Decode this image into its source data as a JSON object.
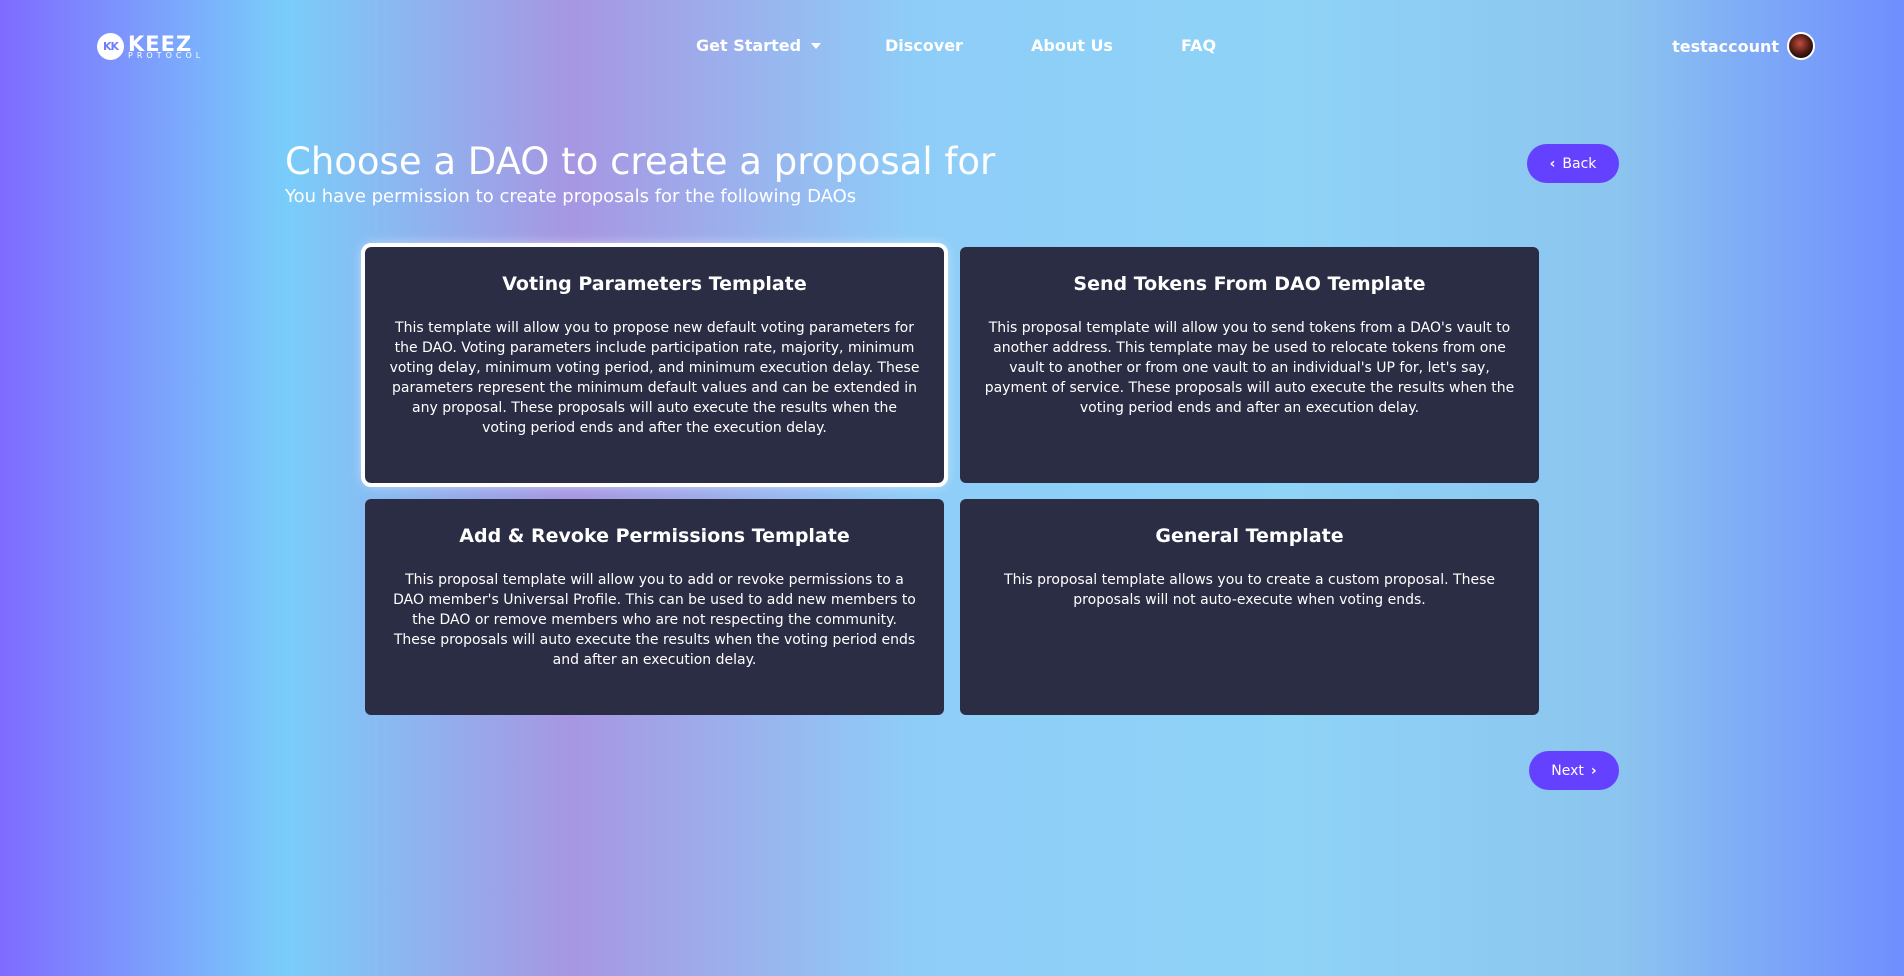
{
  "header": {
    "logo": {
      "mark": "KK",
      "brand_top": "KEEZ",
      "brand_bottom": "PROTOCOL"
    },
    "nav": [
      {
        "label": "Get Started",
        "has_dropdown": true
      },
      {
        "label": "Discover"
      },
      {
        "label": "About Us"
      },
      {
        "label": "FAQ"
      }
    ],
    "account": {
      "username": "testaccount",
      "avatar_icon": "user-avatar"
    }
  },
  "main": {
    "title": "Choose a DAO to create a proposal for",
    "subtitle": "You have permission to create proposals for the following DAOs",
    "back_label": "Back",
    "next_label": "Next",
    "templates": [
      {
        "title": "Voting Parameters Template",
        "description": "This template will allow you to propose new default voting parameters for the DAO. Voting parameters include participation rate, majority, minimum voting delay, minimum voting period, and minimum execution delay. These parameters represent the minimum default values and can be extended in any proposal. These proposals will auto execute the results when the voting period ends and after the execution delay.",
        "selected": true
      },
      {
        "title": "Send Tokens From DAO Template",
        "description": "This proposal template will allow you to send tokens from a DAO's vault to another address. This template may be used to relocate tokens from one vault to another or from one vault to an individual's UP for, let's say, payment of service. These proposals will auto execute the results when the voting period ends and after an execution delay.",
        "selected": false
      },
      {
        "title": "Add & Revoke Permissions Template",
        "description": "This proposal template will allow you to add or revoke permissions to a DAO member's Universal Profile. This can be used to add new members to the DAO or remove members who are not respecting the community. These proposals will auto execute the results when the voting period ends and after an execution delay.",
        "selected": false
      },
      {
        "title": "General Template",
        "description": "This proposal template allows you to create a custom proposal. These proposals will not auto-execute when voting ends.",
        "selected": false
      }
    ]
  },
  "colors": {
    "button": "#6441ff",
    "card": "#2b2d44",
    "text": "#ffffff"
  }
}
